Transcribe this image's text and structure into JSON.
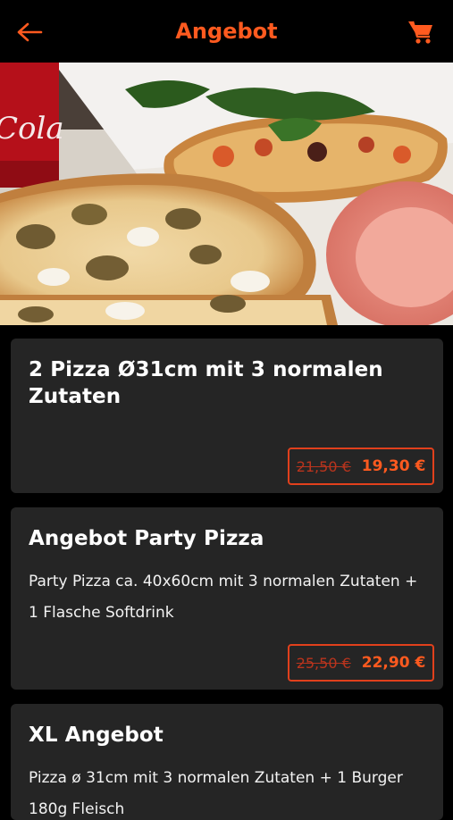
{
  "colors": {
    "accent": "#ff5a1f",
    "background": "#000000",
    "card": "#252525",
    "old_price": "#b9341d"
  },
  "header": {
    "title": "Angebot",
    "back_icon": "arrow-left-icon",
    "cart_icon": "shopping-cart-icon"
  },
  "offers": [
    {
      "title": "2 Pizza Ø31cm mit 3 normalen Zutaten",
      "description": "",
      "old_price": "21,50 €",
      "new_price": "19,30 €"
    },
    {
      "title": "Angebot Party Pizza",
      "description_line1": "Party Pizza ca. 40x60cm mit 3 normalen Zutaten +",
      "description_line2": "1 Flasche Softdrink",
      "old_price": "25,50 €",
      "new_price": "22,90 €"
    },
    {
      "title": "XL Angebot",
      "description_line1": "Pizza ø 31cm mit 3 normalen Zutaten + 1 Burger",
      "description_line2": "180g Fleisch"
    }
  ]
}
